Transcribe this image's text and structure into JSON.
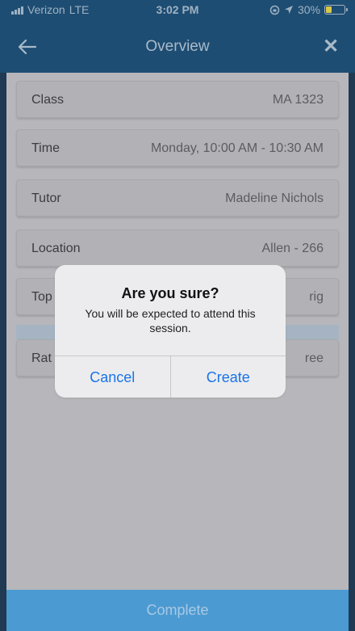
{
  "status_bar": {
    "carrier": "Verizon",
    "network": "LTE",
    "time": "3:02 PM",
    "battery": "30%",
    "battery_level": 0.3
  },
  "nav": {
    "title": "Overview",
    "back_icon": "arrow-left-icon",
    "close_icon": "close-icon"
  },
  "rows": [
    {
      "label": "Class",
      "value": "MA 1323"
    },
    {
      "label": "Time",
      "value": "Monday, 10:00 AM - 10:30 AM"
    },
    {
      "label": "Tutor",
      "value": "Madeline Nichols"
    },
    {
      "label": "Location",
      "value": "Allen  - 266"
    },
    {
      "label": "Top",
      "value": "rig"
    },
    {
      "label": "Rat",
      "value": "ree"
    }
  ],
  "complete_label": "Complete",
  "alert": {
    "title": "Are you sure?",
    "message": "You will be expected to attend this session.",
    "cancel_label": "Cancel",
    "create_label": "Create"
  },
  "colors": {
    "header": "#1e4d73",
    "accent_button": "#4b9ad2",
    "alert_action": "#1a73e8"
  }
}
